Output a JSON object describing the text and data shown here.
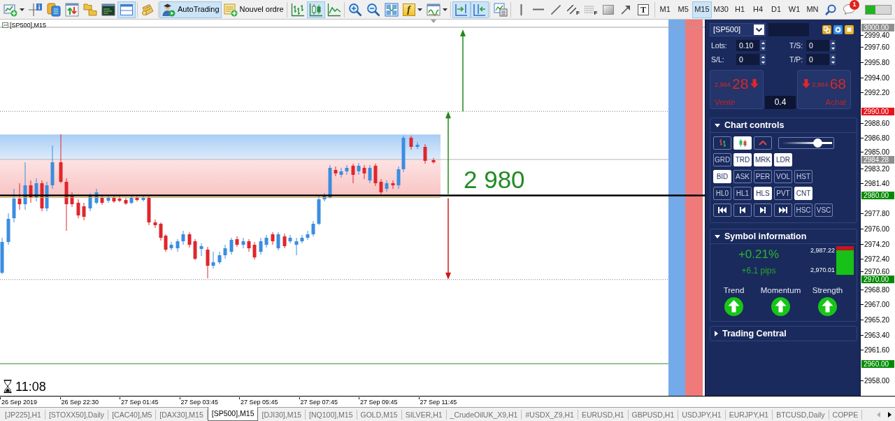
{
  "toolbar": [
    {
      "kind": "icon",
      "pressed": false,
      "dropdown": true
    },
    {
      "kind": "icon",
      "pressed": false
    },
    {
      "kind": "icon",
      "pressed": false
    },
    {
      "kind": "icon",
      "pressed": false
    },
    {
      "kind": "icon",
      "pressed": false
    },
    {
      "kind": "icon",
      "pressed": false
    },
    {
      "kind": "icon",
      "pressed": true
    },
    {
      "kind": "separator"
    },
    {
      "kind": "icon",
      "pressed": false
    },
    {
      "kind": "separator"
    },
    {
      "kind": "text",
      "label": "AutoTrading",
      "pressed": true
    },
    {
      "kind": "text",
      "label": "Nouvel ordre",
      "pressed": false
    },
    {
      "kind": "separator"
    },
    {
      "kind": "icon",
      "pressed": false
    },
    {
      "kind": "icon",
      "pressed": true
    },
    {
      "kind": "icon",
      "pressed": false
    },
    {
      "kind": "separator"
    },
    {
      "kind": "icon",
      "pressed": false
    },
    {
      "kind": "icon",
      "pressed": false
    },
    {
      "kind": "icon",
      "pressed": false
    },
    {
      "kind": "icon",
      "pressed": false,
      "dropdown": true,
      "letter": "f"
    },
    {
      "kind": "icon",
      "pressed": false,
      "dropdown": true
    },
    {
      "kind": "separator"
    },
    {
      "kind": "icon",
      "pressed": true
    },
    {
      "kind": "icon",
      "pressed": true
    },
    {
      "kind": "separator"
    },
    {
      "kind": "icon",
      "pressed": false
    },
    {
      "kind": "separator"
    },
    {
      "kind": "icon",
      "pressed": false
    },
    {
      "kind": "icon",
      "pressed": false
    },
    {
      "kind": "icon",
      "pressed": false
    },
    {
      "kind": "icon",
      "pressed": false,
      "letter": "F"
    },
    {
      "kind": "icon",
      "pressed": false,
      "letter": "F"
    },
    {
      "kind": "icon",
      "pressed": false
    },
    {
      "kind": "icon",
      "pressed": false
    },
    {
      "kind": "icon",
      "pressed": false,
      "letter": "T"
    }
  ],
  "timeframes": [
    {
      "label": "M1",
      "selected": false
    },
    {
      "label": "M5",
      "selected": false
    },
    {
      "label": "M15",
      "selected": true
    },
    {
      "label": "M30",
      "selected": false
    },
    {
      "label": "H1",
      "selected": false
    },
    {
      "label": "H4",
      "selected": false
    },
    {
      "label": "D1",
      "selected": false
    },
    {
      "label": "W1",
      "selected": false
    },
    {
      "label": "MN",
      "selected": false
    }
  ],
  "notifications": {
    "count": "1"
  },
  "chart": {
    "title": "[SP500],M15",
    "level_label": "2 980",
    "timer": "11:08",
    "price_ticks": [
      "2999.40",
      "2997.60",
      "2995.80",
      "2994.00",
      "2992.20",
      "2988.60",
      "2986.80",
      "2985.00",
      "2983.20",
      "2981.40",
      "2977.80",
      "2976.00",
      "2974.20",
      "2972.40",
      "2970.60",
      "2968.80",
      "2967.00",
      "2965.20",
      "2963.40",
      "2961.60",
      "2958.00"
    ],
    "price_tags": [
      {
        "label": "3000.00",
        "color": "#8e8e8e"
      },
      {
        "label": "2990.00",
        "color": "#e8141b"
      },
      {
        "label": "2984.28",
        "color": "#8e8e8e"
      },
      {
        "label": "2980.00",
        "color": "#008a00"
      },
      {
        "label": "2970.00",
        "color": "#008a00"
      },
      {
        "label": "2960.00",
        "color": "#008a00"
      }
    ],
    "time_labels": [
      "26 Sep 2019",
      "26 Sep 22:30",
      "27 Sep 01:45",
      "27 Sep 03:45",
      "27 Sep 05:45",
      "27 Sep 07:45",
      "27 Sep 09:45",
      "27 Sep 11:45"
    ]
  },
  "trade_panel": {
    "symbol": "[SP500]",
    "fields": [
      {
        "label": "Lots:",
        "value": "0.10"
      },
      {
        "label": "T/S:",
        "value": "0"
      },
      {
        "label": "S/L:",
        "value": "0"
      },
      {
        "label": "T/P:",
        "value": "0"
      }
    ],
    "sell": {
      "price_main": "2,984.",
      "price_end": "28",
      "label": "Vente",
      "rising": false
    },
    "buy": {
      "price_main": "2,984.",
      "price_end": "68",
      "label": "Achat",
      "rising": false
    },
    "spread": "0.4",
    "chart_controls": {
      "title": "Chart controls",
      "expanded": true,
      "chart_types": [
        {
          "selected": false
        },
        {
          "selected": true
        },
        {
          "selected": false
        }
      ],
      "zoom": {
        "level": 0.72
      },
      "rows": [
        [
          {
            "kind": "text",
            "label": "GRD",
            "on": false
          },
          {
            "kind": "text",
            "label": "TRD",
            "on": true
          },
          {
            "kind": "text",
            "label": "MRK",
            "on": true
          },
          {
            "kind": "text",
            "label": "LDR",
            "on": true
          }
        ],
        [
          {
            "kind": "text",
            "label": "BID",
            "on": true
          },
          {
            "kind": "text",
            "label": "ASK",
            "on": false
          },
          {
            "kind": "text",
            "label": "PER",
            "on": false
          },
          {
            "kind": "text",
            "label": "VOL",
            "on": false
          },
          {
            "kind": "text",
            "label": "HST",
            "on": false
          }
        ],
        [
          {
            "kind": "text",
            "label": "HL0",
            "on": false
          },
          {
            "kind": "text",
            "label": "HL1",
            "on": false
          },
          {
            "kind": "text",
            "label": "HLS",
            "on": true
          },
          {
            "kind": "text",
            "label": "PVT",
            "on": false
          },
          {
            "kind": "text",
            "label": "CNT",
            "on": true
          }
        ],
        [
          {
            "kind": "icon",
            "on": false
          },
          {
            "kind": "icon",
            "on": false
          },
          {
            "kind": "icon",
            "on": false
          },
          {
            "kind": "icon",
            "on": false
          },
          {
            "kind": "text",
            "label": "HSC",
            "on": false
          },
          {
            "kind": "text",
            "label": "VSC",
            "on": false
          }
        ]
      ]
    },
    "symbol_info": {
      "title": "Symbol information",
      "expanded": true,
      "change": "+0.21%",
      "pips": "+6.1 pips",
      "high": "2,987.22",
      "low": "2,970.01",
      "range": {
        "level": 0.85
      },
      "indicators": [
        {
          "label": "Trend",
          "rising": true
        },
        {
          "label": "Momentum",
          "rising": true
        },
        {
          "label": "Strength",
          "rising": true
        }
      ]
    },
    "trading_central": {
      "title": "Trading Central",
      "expanded": false
    }
  },
  "tabs": [
    {
      "label": "[JP225],H1",
      "selected": false
    },
    {
      "label": "[STOXX50],Daily",
      "selected": false
    },
    {
      "label": "[CAC40],M5",
      "selected": false
    },
    {
      "label": "[DAX30],M15",
      "selected": false
    },
    {
      "label": "[SP500],M15",
      "selected": true
    },
    {
      "label": "[DJI30],M15",
      "selected": false
    },
    {
      "label": "[NQ100],M15",
      "selected": false
    },
    {
      "label": "GOLD,M15",
      "selected": false
    },
    {
      "label": "SILVER,H1",
      "selected": false
    },
    {
      "label": "_CrudeOilUK_X9,H1",
      "selected": false
    },
    {
      "label": "#USDX_Z9,H1",
      "selected": false
    },
    {
      "label": "EURUSD,H1",
      "selected": false
    },
    {
      "label": "GBPUSD,H1",
      "selected": false
    },
    {
      "label": "USDJPY,H1",
      "selected": false
    },
    {
      "label": "EURJPY,H1",
      "selected": false
    },
    {
      "label": "BTCUSD,Daily",
      "selected": false
    },
    {
      "label": "COPPE",
      "selected": false
    }
  ],
  "tab_scroll": [
    {
      "disabled": true
    },
    {
      "disabled": false
    }
  ]
}
